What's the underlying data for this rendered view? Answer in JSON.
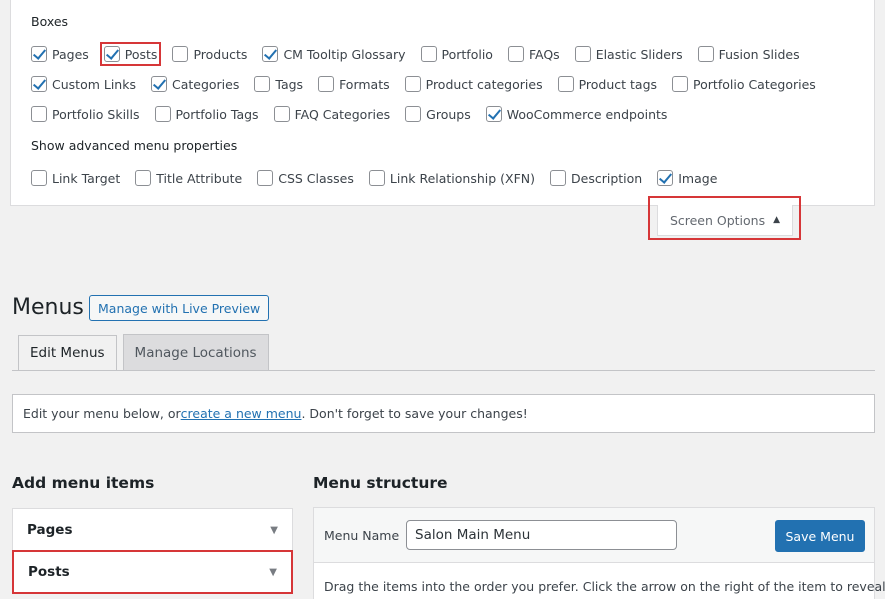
{
  "screen_options": {
    "boxes_heading": "Boxes",
    "boxes_rows": [
      [
        {
          "label": "Pages",
          "checked": true
        },
        {
          "label": "Posts",
          "checked": true,
          "highlight": true
        },
        {
          "label": "Products",
          "checked": false
        },
        {
          "label": "CM Tooltip Glossary",
          "checked": true
        },
        {
          "label": "Portfolio",
          "checked": false
        },
        {
          "label": "FAQs",
          "checked": false
        },
        {
          "label": "Elastic Sliders",
          "checked": false
        },
        {
          "label": "Fusion Slides",
          "checked": false
        }
      ],
      [
        {
          "label": "Custom Links",
          "checked": true
        },
        {
          "label": "Categories",
          "checked": true
        },
        {
          "label": "Tags",
          "checked": false
        },
        {
          "label": "Formats",
          "checked": false
        },
        {
          "label": "Product categories",
          "checked": false
        },
        {
          "label": "Product tags",
          "checked": false
        },
        {
          "label": "Portfolio Categories",
          "checked": false
        }
      ],
      [
        {
          "label": "Portfolio Skills",
          "checked": false
        },
        {
          "label": "Portfolio Tags",
          "checked": false
        },
        {
          "label": "FAQ Categories",
          "checked": false
        },
        {
          "label": "Groups",
          "checked": false
        },
        {
          "label": "WooCommerce endpoints",
          "checked": true
        }
      ]
    ],
    "advanced_heading": "Show advanced menu properties",
    "advanced_items": [
      {
        "label": "Link Target",
        "checked": false
      },
      {
        "label": "Title Attribute",
        "checked": false
      },
      {
        "label": "CSS Classes",
        "checked": false
      },
      {
        "label": "Link Relationship (XFN)",
        "checked": false
      },
      {
        "label": "Description",
        "checked": false
      },
      {
        "label": "Image",
        "checked": true
      }
    ],
    "toggle_label": "Screen Options",
    "toggle_arrow": "▲"
  },
  "page": {
    "title": "Menus",
    "live_preview_label": "Manage with Live Preview",
    "tabs": [
      {
        "label": "Edit Menus",
        "active": true
      },
      {
        "label": "Manage Locations",
        "active": false
      }
    ]
  },
  "notice": {
    "before": "Edit your menu below, or ",
    "link": "create a new menu",
    "after": ". Don't forget to save your changes!"
  },
  "add_items": {
    "title": "Add menu items",
    "sections": [
      {
        "label": "Pages",
        "highlight": false
      },
      {
        "label": "Posts",
        "highlight": true
      }
    ],
    "toggle_glyph": "▼"
  },
  "menu_structure": {
    "title": "Menu structure",
    "name_label": "Menu Name",
    "name_value": "Salon Main Menu",
    "save_label": "Save Menu",
    "instructions": "Drag the items into the order you prefer. Click the arrow on the right of the item to reveal"
  },
  "colors": {
    "accent": "#2271b1",
    "highlight": "#d63638"
  }
}
